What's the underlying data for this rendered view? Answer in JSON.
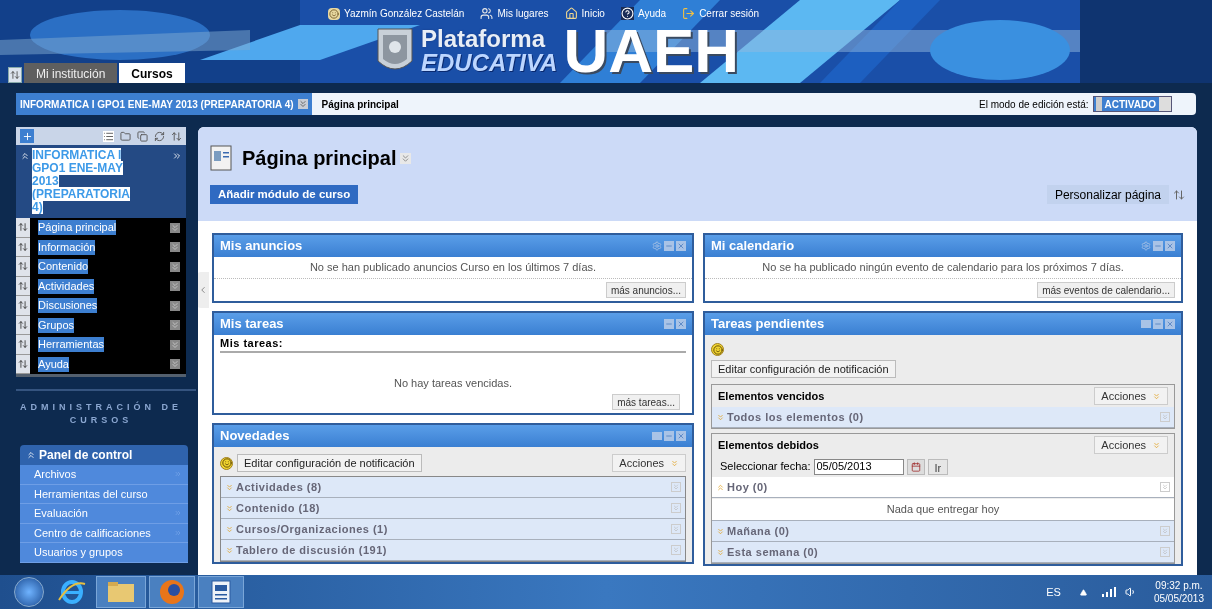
{
  "header": {
    "user": "Yazmín González Castelán",
    "links": [
      {
        "label": "Mis lugares",
        "kind": "places"
      },
      {
        "label": "Inicio",
        "kind": "home"
      },
      {
        "label": "Ayuda",
        "kind": "help"
      },
      {
        "label": "Cerrar sesión",
        "kind": "logout"
      }
    ],
    "logo": {
      "line1": "Plataforma",
      "line2": "EDUCATIVA",
      "mark": "UAEH"
    },
    "tabs": [
      {
        "label": "Mi institución",
        "selected": false
      },
      {
        "label": "Cursos",
        "selected": true
      }
    ]
  },
  "breadcrumb": {
    "course": "INFORMATICA I GPO1 ENE-MAY 2013 (PREPARATORIA 4)",
    "page": "Página principal",
    "edit_label": "El modo de edición está:",
    "edit_mode": {
      "label": "ACTIVADO",
      "on": true
    }
  },
  "course_menu": {
    "title": "INFORMATICA I GPO1 ENE-MAY 2013 (PREPARATORIA 4)",
    "items": [
      "Página principal",
      "Información",
      "Contenido",
      "Actividades",
      "Discusiones",
      "Grupos",
      "Herramientas",
      "Ayuda"
    ]
  },
  "admin": {
    "heading": "ADMINISTRACIÓN DE CURSOS",
    "panel": {
      "title": "Panel de control",
      "expanded": true,
      "items": [
        {
          "label": "Archivos",
          "submenu": true
        },
        {
          "label": "Herramientas del curso",
          "submenu": false
        },
        {
          "label": "Evaluación",
          "submenu": true
        },
        {
          "label": "Centro de calificaciones",
          "submenu": true
        },
        {
          "label": "Usuarios y grupos",
          "submenu": false
        }
      ]
    }
  },
  "page": {
    "title": "Página principal",
    "add_button": "Añadir módulo de curso",
    "customize_button": "Personalizar página"
  },
  "columns": [
    [
      {
        "kind": "message",
        "title": "Mis anuncios",
        "settings": true,
        "popout": false,
        "message": "No se han publicado anuncios Curso en los últimos 7 días.",
        "more": "más anuncios..."
      },
      {
        "kind": "tasks",
        "title": "Mis tareas",
        "settings": false,
        "popout": false,
        "subtitle": "Mis tareas:",
        "message": "No hay tareas vencidas.",
        "more": "más tareas..."
      },
      {
        "kind": "news",
        "title": "Novedades",
        "settings": false,
        "popout": true,
        "notify_button": "Editar configuración de notificación",
        "actions": "Acciones",
        "sections": [
          {
            "label": "Actividades (8)",
            "expanded": false
          },
          {
            "label": "Contenido (18)",
            "expanded": false
          },
          {
            "label": "Cursos/Organizaciones (1)",
            "expanded": false
          },
          {
            "label": "Tablero de discusión (191)",
            "expanded": false
          }
        ]
      }
    ],
    [
      {
        "kind": "message",
        "title": "Mi calendario",
        "settings": true,
        "popout": false,
        "message": "No se ha publicado ningún evento de calendario para los próximos 7 días.",
        "more": "más eventos de calendario..."
      },
      {
        "kind": "pending",
        "title": "Tareas pendientes",
        "settings": false,
        "popout": true,
        "notify_button": "Editar configuración de notificación",
        "groups": [
          {
            "title": "Elementos vencidos",
            "actions": "Acciones",
            "sections": [
              {
                "label": "Todos los elementos (0)",
                "expanded": false
              }
            ]
          },
          {
            "title": "Elementos debidos",
            "actions": "Acciones",
            "date_label": "Seleccionar fecha:",
            "date": "05/05/2013",
            "go": "Ir",
            "sections": [
              {
                "label": "Hoy (0)",
                "expanded": true,
                "empty": "Nada que entregar hoy"
              },
              {
                "label": "Mañana (0)",
                "expanded": false
              },
              {
                "label": "Esta semana (0)",
                "expanded": false
              }
            ]
          }
        ]
      }
    ]
  ],
  "taskbar": {
    "language": "ES",
    "time": "09:32 p.m.",
    "date": "05/05/2013"
  }
}
